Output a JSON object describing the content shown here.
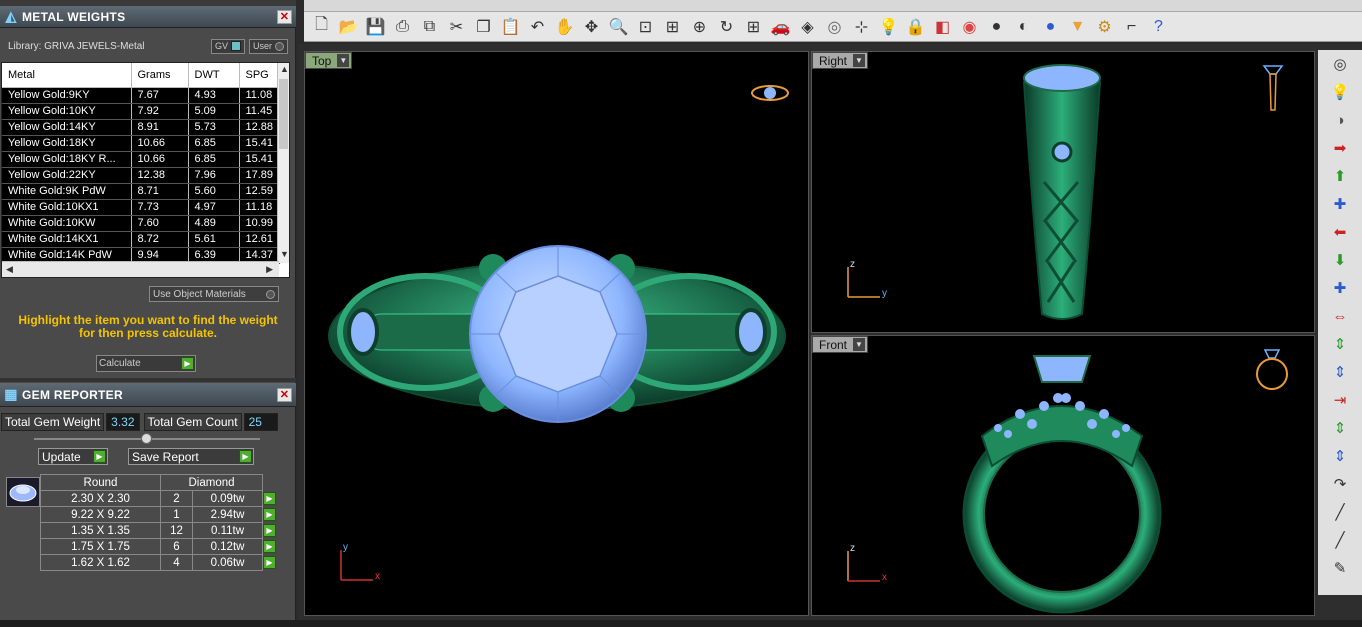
{
  "metal_weights": {
    "title": "METAL WEIGHTS",
    "library": "Library: GRIVA JEWELS-Metal",
    "gv_label": "GV",
    "user_label": "User",
    "columns": [
      "Metal",
      "Grams",
      "DWT",
      "SPG"
    ],
    "rows": [
      [
        "Yellow Gold:9KY",
        "7.67",
        "4.93",
        "11.08"
      ],
      [
        "Yellow Gold:10KY",
        "7.92",
        "5.09",
        "11.45"
      ],
      [
        "Yellow Gold:14KY",
        "8.91",
        "5.73",
        "12.88"
      ],
      [
        "Yellow Gold:18KY",
        "10.66",
        "6.85",
        "15.41"
      ],
      [
        "Yellow Gold:18KY R...",
        "10.66",
        "6.85",
        "15.41"
      ],
      [
        "Yellow Gold:22KY",
        "12.38",
        "7.96",
        "17.89"
      ],
      [
        "White Gold:9K PdW",
        "8.71",
        "5.60",
        "12.59"
      ],
      [
        "White Gold:10KX1",
        "7.73",
        "4.97",
        "11.18"
      ],
      [
        "White Gold:10KW",
        "7.60",
        "4.89",
        "10.99"
      ],
      [
        "White Gold:14KX1",
        "8.72",
        "5.61",
        "12.61"
      ],
      [
        "White Gold:14K PdW",
        "9.94",
        "6.39",
        "14.37"
      ]
    ],
    "use_object_materials": "Use Object Materials",
    "hint": "Highlight the item you want to find the weight for then press calculate.",
    "calculate_label": "Calculate"
  },
  "gem_reporter": {
    "title": "GEM REPORTER",
    "total_weight_label": "Total Gem Weight",
    "total_weight": "3.32",
    "total_count_label": "Total Gem Count",
    "total_count": "25",
    "update_label": "Update",
    "save_label": "Save Report",
    "shape": "Round",
    "material": "Diamond",
    "gems": [
      [
        "2.30 X 2.30",
        "2",
        "0.09tw"
      ],
      [
        "9.22 X 9.22",
        "1",
        "2.94tw"
      ],
      [
        "1.35 X 1.35",
        "12",
        "0.11tw"
      ],
      [
        "1.75 X 1.75",
        "6",
        "0.12tw"
      ],
      [
        "1.62 X 1.62",
        "4",
        "0.06tw"
      ]
    ]
  },
  "viewports": {
    "top": "Top",
    "right": "Right",
    "front": "Front"
  },
  "axes": {
    "x": "x",
    "y": "y",
    "z": "z"
  },
  "icons": {
    "toolbar": [
      "new-file-icon",
      "open-folder-icon",
      "save-icon",
      "print-icon",
      "copy-file-icon",
      "cut-icon",
      "copy-icon",
      "paste-icon",
      "undo-icon",
      "pan-hand-icon",
      "rotate-view-icon",
      "zoom-icon",
      "zoom-window-icon",
      "zoom-extents-icon",
      "zoom-selected-icon",
      "refresh-icon",
      "four-view-icon",
      "car-render-icon",
      "render-mode-icon",
      "snap-icon",
      "gumball-icon",
      "light-icon",
      "lock-icon",
      "layer-icon",
      "color-wheel-icon",
      "shade-icon",
      "material-icon",
      "render-sphere-icon",
      "cone-icon",
      "gear-icon",
      "dimension-icon",
      "help-icon"
    ],
    "right_toolbar": [
      "camera-icon",
      "bulb-icon",
      "sphere-icon",
      "move-right-icon",
      "move-up-icon",
      "move-axis-icon",
      "move-left-icon",
      "move-down-icon",
      "move-axis-down-icon",
      "scale-x-icon",
      "scale-y-icon",
      "scale-z-icon",
      "shrink-icon",
      "stretch-y-icon",
      "scale-axis-icon",
      "curve-icon",
      "line-icon",
      "line-diagonal-icon",
      "eraser-icon"
    ]
  },
  "colors": {
    "accent_green": "#4fae2f",
    "hint_yellow": "#f4c400",
    "ring_green": "#1f7a54",
    "gem_blue": "#8eb6ff"
  }
}
